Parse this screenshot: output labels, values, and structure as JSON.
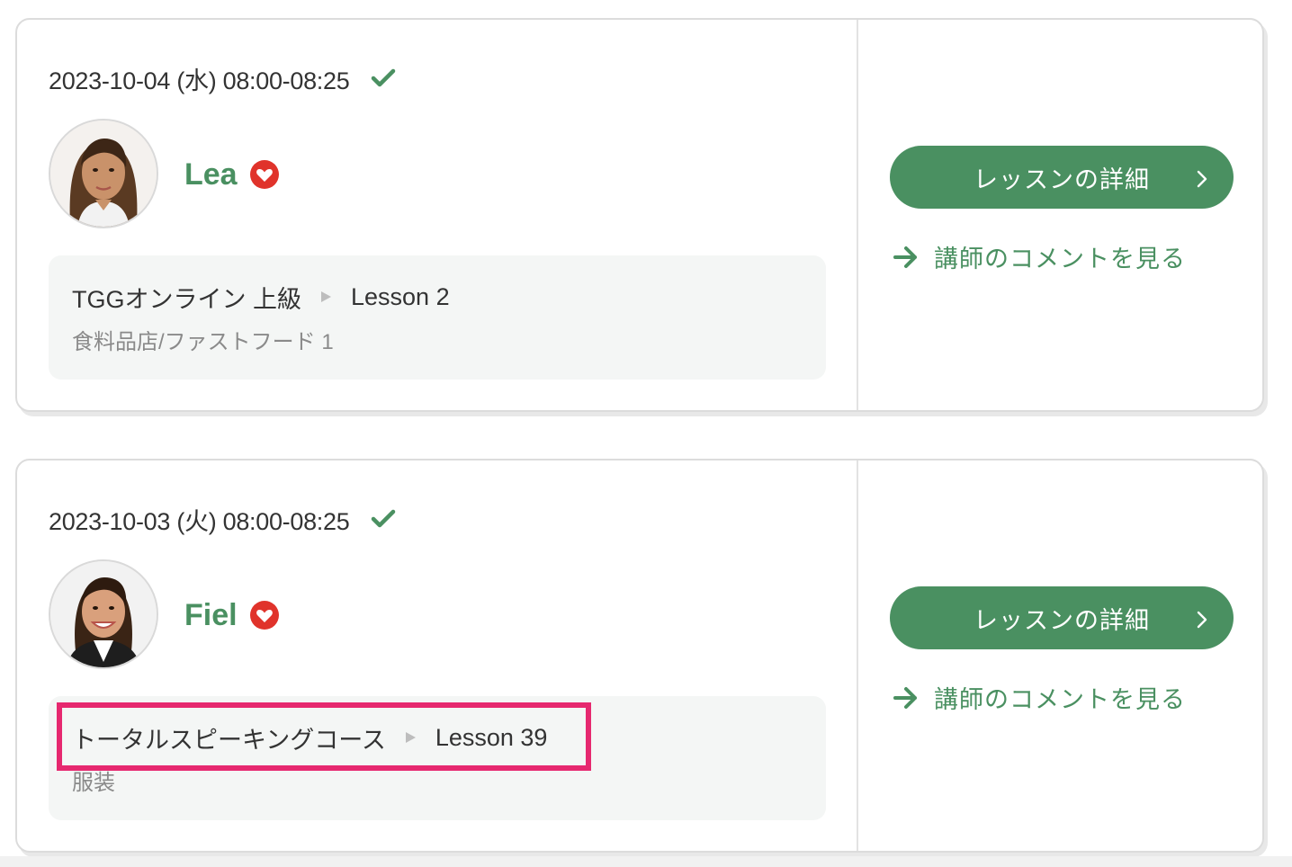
{
  "lessons": [
    {
      "datetime": "2023-10-04 (水) 08:00-08:25",
      "status_icon": "check-icon",
      "teacher": {
        "name": "Lea",
        "favorite_icon": "heart-icon",
        "avatar": "teacher-photo"
      },
      "course": "TGGオンライン 上級",
      "lesson": "Lesson 2",
      "topic": "食料品店/ファストフード 1",
      "detail_button_label": "レッスンの詳細",
      "comment_link_label": "講師のコメントを見る"
    },
    {
      "datetime": "2023-10-03 (火) 08:00-08:25",
      "status_icon": "check-icon",
      "teacher": {
        "name": "Fiel",
        "favorite_icon": "heart-icon",
        "avatar": "teacher-photo"
      },
      "course": "トータルスピーキングコース",
      "lesson": "Lesson 39",
      "topic": "服装",
      "detail_button_label": "レッスンの詳細",
      "comment_link_label": "講師のコメントを見る"
    }
  ],
  "colors": {
    "accent_green": "#4a9061",
    "favorite_red": "#e0332b",
    "highlight_pink": "#e6286f"
  }
}
